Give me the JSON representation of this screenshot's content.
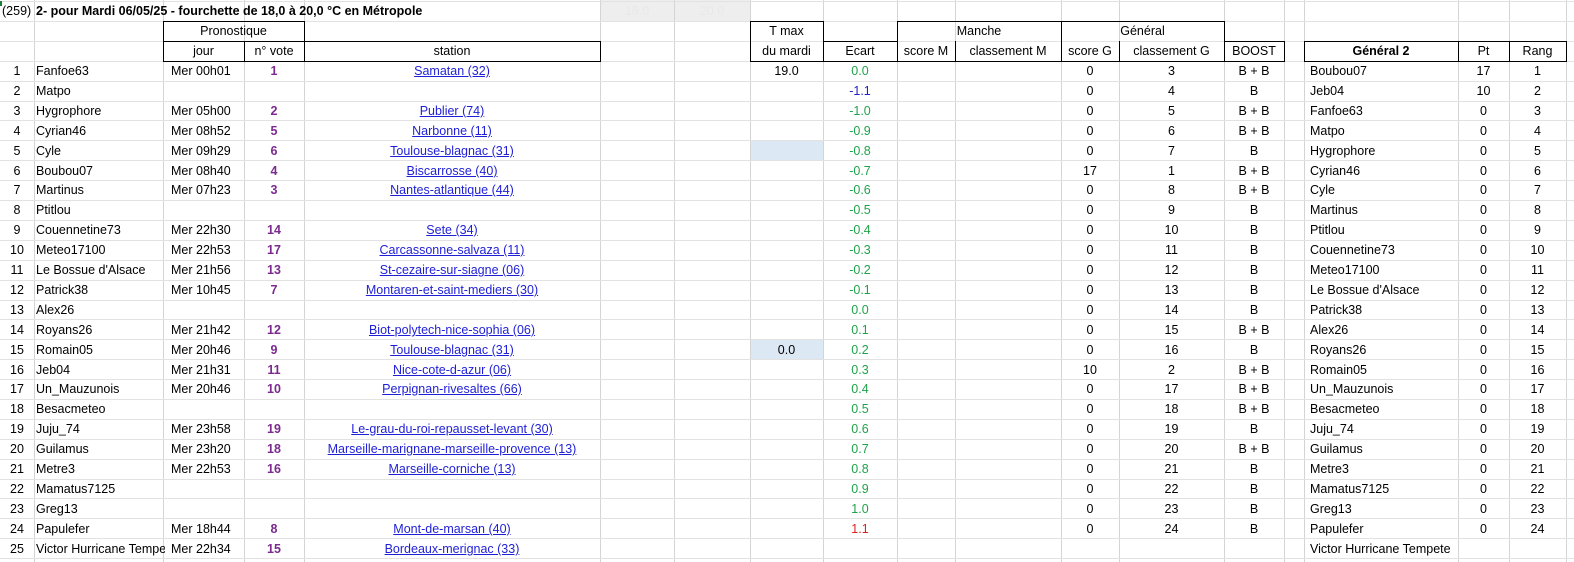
{
  "title": {
    "prefix": "(259)",
    "text": "2- pour Mardi 06/05/25 - fourchette de 18,0 à 20,0 °C en Métropole"
  },
  "range_boxes": [
    "18.0",
    "20.0"
  ],
  "headers": {
    "pronostique": "Pronostique",
    "jour": "jour",
    "nvote": "n° vote",
    "station": "station",
    "tmax_top": "T max",
    "tmax_bottom": "du mardi",
    "ecart": "Ecart",
    "manche": "Manche",
    "score_m": "score M",
    "classement_m": "classement M",
    "general": "Général",
    "score_g": "score G",
    "classement_g": "classement G",
    "boost": "BOOST",
    "general2": "Général 2",
    "pt": "Pt",
    "rang": "Rang"
  },
  "colors": {
    "link": "#1f1fd6",
    "vote": "#7b2a8e",
    "ecart_pos": "#1fa34a",
    "ecart_neg": "#2222cc",
    "ecart_out": "#e02020",
    "highlight": "#dce9f5"
  },
  "rows": [
    {
      "n": "1",
      "name": "Fanfoe63",
      "jour": "Mer 00h01",
      "vote": "1",
      "station": "Samatan (32)",
      "tmax": "19.0",
      "ecart": "0.0",
      "ec": "g",
      "scoreg": "0",
      "classg": "3",
      "boost": "B + B",
      "g2": "Boubou07",
      "pt": "17",
      "rang": "1"
    },
    {
      "n": "2",
      "name": "Matpo",
      "jour": "",
      "vote": "",
      "station": "",
      "tmax": "",
      "ecart": "-1.1",
      "ec": "b",
      "scoreg": "0",
      "classg": "4",
      "boost": "B",
      "g2": "Jeb04",
      "pt": "10",
      "rang": "2"
    },
    {
      "n": "3",
      "name": "Hygrophore",
      "jour": "Mer 05h00",
      "vote": "2",
      "station": "Publier (74)",
      "tmax": "",
      "ecart": "-1.0",
      "ec": "g",
      "scoreg": "0",
      "classg": "5",
      "boost": "B + B",
      "g2": "Fanfoe63",
      "pt": "0",
      "rang": "3"
    },
    {
      "n": "4",
      "name": "Cyrian46",
      "jour": "Mer 08h52",
      "vote": "5",
      "station": "Narbonne (11)",
      "tmax": "",
      "ecart": "-0.9",
      "ec": "g",
      "scoreg": "0",
      "classg": "6",
      "boost": "B + B",
      "g2": "Matpo",
      "pt": "0",
      "rang": "4"
    },
    {
      "n": "5",
      "name": "Cyle",
      "jour": "Mer 09h29",
      "vote": "6",
      "station": "Toulouse-blagnac (31)",
      "tmax": "",
      "ecart": "-0.8",
      "ec": "g",
      "scoreg": "0",
      "classg": "7",
      "boost": "B",
      "g2": "Hygrophore",
      "pt": "0",
      "rang": "5",
      "hl": true
    },
    {
      "n": "6",
      "name": "Boubou07",
      "jour": "Mer 08h40",
      "vote": "4",
      "station": "Biscarrosse (40)",
      "tmax": "",
      "ecart": "-0.7",
      "ec": "g",
      "scoreg": "17",
      "classg": "1",
      "boost": "B + B",
      "g2": "Cyrian46",
      "pt": "0",
      "rang": "6"
    },
    {
      "n": "7",
      "name": "Martinus",
      "jour": "Mer 07h23",
      "vote": "3",
      "station": "Nantes-atlantique (44)",
      "tmax": "",
      "ecart": "-0.6",
      "ec": "g",
      "scoreg": "0",
      "classg": "8",
      "boost": "B + B",
      "g2": "Cyle",
      "pt": "0",
      "rang": "7"
    },
    {
      "n": "8",
      "name": "Ptitlou",
      "jour": "",
      "vote": "",
      "station": "",
      "tmax": "",
      "ecart": "-0.5",
      "ec": "g",
      "scoreg": "0",
      "classg": "9",
      "boost": "B",
      "g2": "Martinus",
      "pt": "0",
      "rang": "8"
    },
    {
      "n": "9",
      "name": "Couennetine73",
      "jour": "Mer 22h30",
      "vote": "14",
      "station": "Sete (34)",
      "tmax": "",
      "ecart": "-0.4",
      "ec": "g",
      "scoreg": "0",
      "classg": "10",
      "boost": "B",
      "g2": "Ptitlou",
      "pt": "0",
      "rang": "9"
    },
    {
      "n": "10",
      "name": "Meteo17100",
      "jour": "Mer 22h53",
      "vote": "17",
      "station": "Carcassonne-salvaza (11)",
      "tmax": "",
      "ecart": "-0.3",
      "ec": "g",
      "scoreg": "0",
      "classg": "11",
      "boost": "B",
      "g2": "Couennetine73",
      "pt": "0",
      "rang": "10"
    },
    {
      "n": "11",
      "name": "Le Bossue d'Alsace",
      "jour": "Mer 21h56",
      "vote": "13",
      "station": "St-cezaire-sur-siagne (06)",
      "tmax": "",
      "ecart": "-0.2",
      "ec": "g",
      "scoreg": "0",
      "classg": "12",
      "boost": "B",
      "g2": "Meteo17100",
      "pt": "0",
      "rang": "11"
    },
    {
      "n": "12",
      "name": "Patrick38",
      "jour": "Mer 10h45",
      "vote": "7",
      "station": "Montaren-et-saint-mediers (30)",
      "tmax": "",
      "ecart": "-0.1",
      "ec": "g",
      "scoreg": "0",
      "classg": "13",
      "boost": "B",
      "g2": "Le Bossue d'Alsace",
      "pt": "0",
      "rang": "12"
    },
    {
      "n": "13",
      "name": "Alex26",
      "jour": "",
      "vote": "",
      "station": "",
      "tmax": "",
      "ecart": "0.0",
      "ec": "g",
      "scoreg": "0",
      "classg": "14",
      "boost": "B",
      "g2": "Patrick38",
      "pt": "0",
      "rang": "13"
    },
    {
      "n": "14",
      "name": "Royans26",
      "jour": "Mer 21h42",
      "vote": "12",
      "station": "Biot-polytech-nice-sophia (06)",
      "tmax": "",
      "ecart": "0.1",
      "ec": "g",
      "scoreg": "0",
      "classg": "15",
      "boost": "B + B",
      "g2": "Alex26",
      "pt": "0",
      "rang": "14"
    },
    {
      "n": "15",
      "name": "Romain05",
      "jour": "Mer 20h46",
      "vote": "9",
      "station": "Toulouse-blagnac (31)",
      "tmax": "0.0",
      "ecart": "0.2",
      "ec": "g",
      "scoreg": "0",
      "classg": "16",
      "boost": "B",
      "g2": "Royans26",
      "pt": "0",
      "rang": "15",
      "hl": true
    },
    {
      "n": "16",
      "name": "Jeb04",
      "jour": "Mer 21h31",
      "vote": "11",
      "station": "Nice-cote-d-azur (06)",
      "tmax": "",
      "ecart": "0.3",
      "ec": "g",
      "scoreg": "10",
      "classg": "2",
      "boost": "B + B",
      "g2": "Romain05",
      "pt": "0",
      "rang": "16"
    },
    {
      "n": "17",
      "name": "Un_Mauzunois",
      "jour": "Mer 20h46",
      "vote": "10",
      "station": "Perpignan-rivesaltes (66)",
      "tmax": "",
      "ecart": "0.4",
      "ec": "g",
      "scoreg": "0",
      "classg": "17",
      "boost": "B + B",
      "g2": "Un_Mauzunois",
      "pt": "0",
      "rang": "17"
    },
    {
      "n": "18",
      "name": "Besacmeteo",
      "jour": "",
      "vote": "",
      "station": "",
      "tmax": "",
      "ecart": "0.5",
      "ec": "g",
      "scoreg": "0",
      "classg": "18",
      "boost": "B + B",
      "g2": "Besacmeteo",
      "pt": "0",
      "rang": "18"
    },
    {
      "n": "19",
      "name": "Juju_74",
      "jour": "Mer 23h58",
      "vote": "19",
      "station": "Le-grau-du-roi-repausset-levant (30)",
      "tmax": "",
      "ecart": "0.6",
      "ec": "g",
      "scoreg": "0",
      "classg": "19",
      "boost": "B",
      "g2": "Juju_74",
      "pt": "0",
      "rang": "19"
    },
    {
      "n": "20",
      "name": "Guilamus",
      "jour": "Mer 23h20",
      "vote": "18",
      "station": "Marseille-marignane-marseille-provence (13)",
      "tmax": "",
      "ecart": "0.7",
      "ec": "g",
      "scoreg": "0",
      "classg": "20",
      "boost": "B + B",
      "g2": "Guilamus",
      "pt": "0",
      "rang": "20"
    },
    {
      "n": "21",
      "name": "Metre3",
      "jour": "Mer 22h53",
      "vote": "16",
      "station": "Marseille-corniche (13)",
      "tmax": "",
      "ecart": "0.8",
      "ec": "g",
      "scoreg": "0",
      "classg": "21",
      "boost": "B",
      "g2": "Metre3",
      "pt": "0",
      "rang": "21"
    },
    {
      "n": "22",
      "name": "Mamatus7125",
      "jour": "",
      "vote": "",
      "station": "",
      "tmax": "",
      "ecart": "0.9",
      "ec": "g",
      "scoreg": "0",
      "classg": "22",
      "boost": "B",
      "g2": "Mamatus7125",
      "pt": "0",
      "rang": "22"
    },
    {
      "n": "23",
      "name": "Greg13",
      "jour": "",
      "vote": "",
      "station": "",
      "tmax": "",
      "ecart": "1.0",
      "ec": "g",
      "scoreg": "0",
      "classg": "23",
      "boost": "B",
      "g2": "Greg13",
      "pt": "0",
      "rang": "23"
    },
    {
      "n": "24",
      "name": "Papulefer",
      "jour": "Mer 18h44",
      "vote": "8",
      "station": "Mont-de-marsan (40)",
      "tmax": "",
      "ecart": "1.1",
      "ec": "r",
      "scoreg": "0",
      "classg": "24",
      "boost": "B",
      "g2": "Papulefer",
      "pt": "0",
      "rang": "24"
    },
    {
      "n": "25",
      "name": "Victor Hurricane Tempete",
      "jour": "Mer 22h34",
      "vote": "15",
      "station": "Bordeaux-merignac (33)",
      "tmax": "",
      "ecart": "",
      "ec": "g",
      "scoreg": "",
      "classg": "",
      "boost": "",
      "g2": "Victor Hurricane Tempete",
      "pt": "",
      "rang": ""
    }
  ]
}
